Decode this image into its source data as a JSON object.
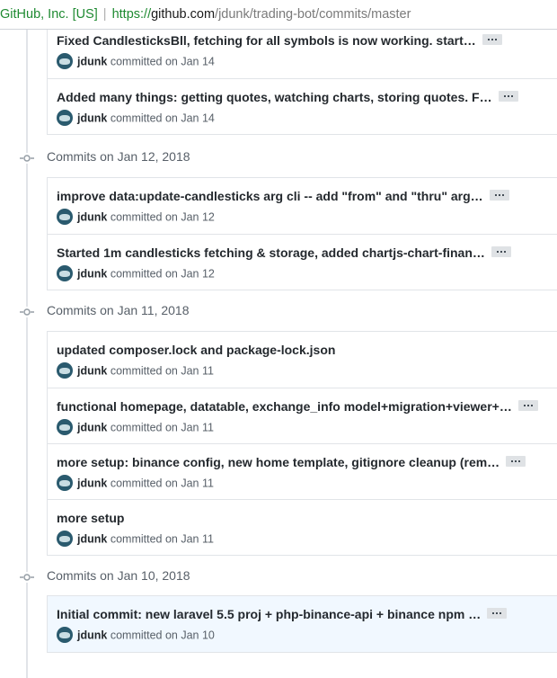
{
  "browser": {
    "cert_label": "GitHub, Inc. [US]",
    "url_scheme": "https://",
    "url_host": "github.com",
    "url_path": "/jdunk/trading-bot/commits/master"
  },
  "colors": {
    "cert_green": "#1e8a31",
    "text": "#24292e",
    "muted": "#586069",
    "border": "#e1e4e8",
    "highlight": "#f1f8ff"
  },
  "partial_group": {
    "commits": [
      {
        "message": "Fixed CandlesticksBll, fetching for all symbols is now working. start…",
        "author": "jdunk",
        "action": "committed",
        "date": "on Jan 14"
      },
      {
        "message": "Added many things: getting quotes, watching charts, storing quotes. F…",
        "author": "jdunk",
        "action": "committed",
        "date": "on Jan 14"
      }
    ]
  },
  "groups": [
    {
      "title": "Commits on Jan 12, 2018",
      "commits": [
        {
          "message": "improve data:update-candlesticks arg cli -- add \"from\" and \"thru\" arg…",
          "author": "jdunk",
          "action": "committed",
          "date": "on Jan 12"
        },
        {
          "message": "Started 1m candlesticks fetching & storage, added chartjs-chart-finan…",
          "author": "jdunk",
          "action": "committed",
          "date": "on Jan 12"
        }
      ]
    },
    {
      "title": "Commits on Jan 11, 2018",
      "commits": [
        {
          "message": "updated composer.lock and package-lock.json",
          "author": "jdunk",
          "action": "committed",
          "date": "on Jan 11"
        },
        {
          "message": "functional homepage, datatable, exchange_info model+migration+viewer+…",
          "author": "jdunk",
          "action": "committed",
          "date": "on Jan 11"
        },
        {
          "message": "more setup: binance config, new home template, gitignore cleanup (rem…",
          "author": "jdunk",
          "action": "committed",
          "date": "on Jan 11"
        },
        {
          "message": "more setup",
          "author": "jdunk",
          "action": "committed",
          "date": "on Jan 11"
        }
      ]
    },
    {
      "title": "Commits on Jan 10, 2018",
      "commits": [
        {
          "message": "Initial commit: new laravel 5.5 proj + php-binance-api + binance npm …",
          "author": "jdunk",
          "action": "committed",
          "date": "on Jan 10"
        }
      ]
    }
  ]
}
